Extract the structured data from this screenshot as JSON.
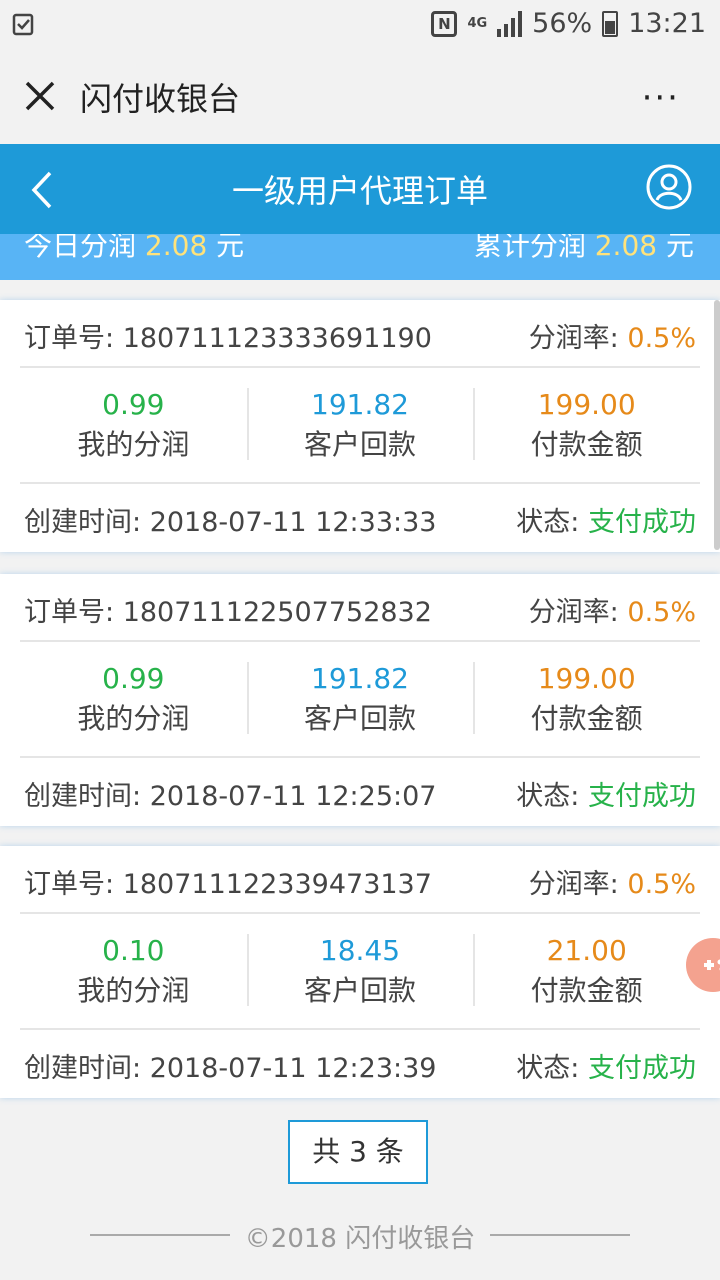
{
  "status_bar": {
    "network": "4G",
    "battery": "56%",
    "time": "13:21",
    "icons": [
      "notification-icon",
      "nfc-icon",
      "signal-icon",
      "battery-icon"
    ]
  },
  "app_bar": {
    "title": "闪付收银台",
    "more": "···"
  },
  "header": {
    "title": "一级用户代理订单"
  },
  "summary": {
    "today_label": "今日分润",
    "today_value": "2.08",
    "today_unit": "元",
    "total_label": "累计分润",
    "total_value": "2.08",
    "total_unit": "元"
  },
  "orders": [
    {
      "order_label": "订单号:",
      "order_no": "180711123333691190",
      "rate_label": "分润率:",
      "rate": "0.5%",
      "my_profit": "0.99",
      "my_profit_label": "我的分润",
      "refund": "191.82",
      "refund_label": "客户回款",
      "amount": "199.00",
      "amount_label": "付款金额",
      "time_label": "创建时间:",
      "time": "2018-07-11 12:33:33",
      "status_label": "状态:",
      "status": "支付成功"
    },
    {
      "order_label": "订单号:",
      "order_no": "180711122507752832",
      "rate_label": "分润率:",
      "rate": "0.5%",
      "my_profit": "0.99",
      "my_profit_label": "我的分润",
      "refund": "191.82",
      "refund_label": "客户回款",
      "amount": "199.00",
      "amount_label": "付款金额",
      "time_label": "创建时间:",
      "time": "2018-07-11 12:25:07",
      "status_label": "状态:",
      "status": "支付成功"
    },
    {
      "order_label": "订单号:",
      "order_no": "180711122339473137",
      "rate_label": "分润率:",
      "rate": "0.5%",
      "my_profit": "0.10",
      "my_profit_label": "我的分润",
      "refund": "18.45",
      "refund_label": "客户回款",
      "amount": "21.00",
      "amount_label": "付款金额",
      "time_label": "创建时间:",
      "time": "2018-07-11 12:23:39",
      "status_label": "状态:",
      "status": "支付成功"
    }
  ],
  "pagination": {
    "total_text": "共 3 条"
  },
  "footer": {
    "copyright": "©2018 闪付收银台"
  },
  "colors": {
    "header_blue": "#1e9ad8",
    "summary_blue": "#58b4f5",
    "profit_green": "#27b24a",
    "refund_blue": "#1e9ad8",
    "amount_orange": "#e68a1a"
  }
}
